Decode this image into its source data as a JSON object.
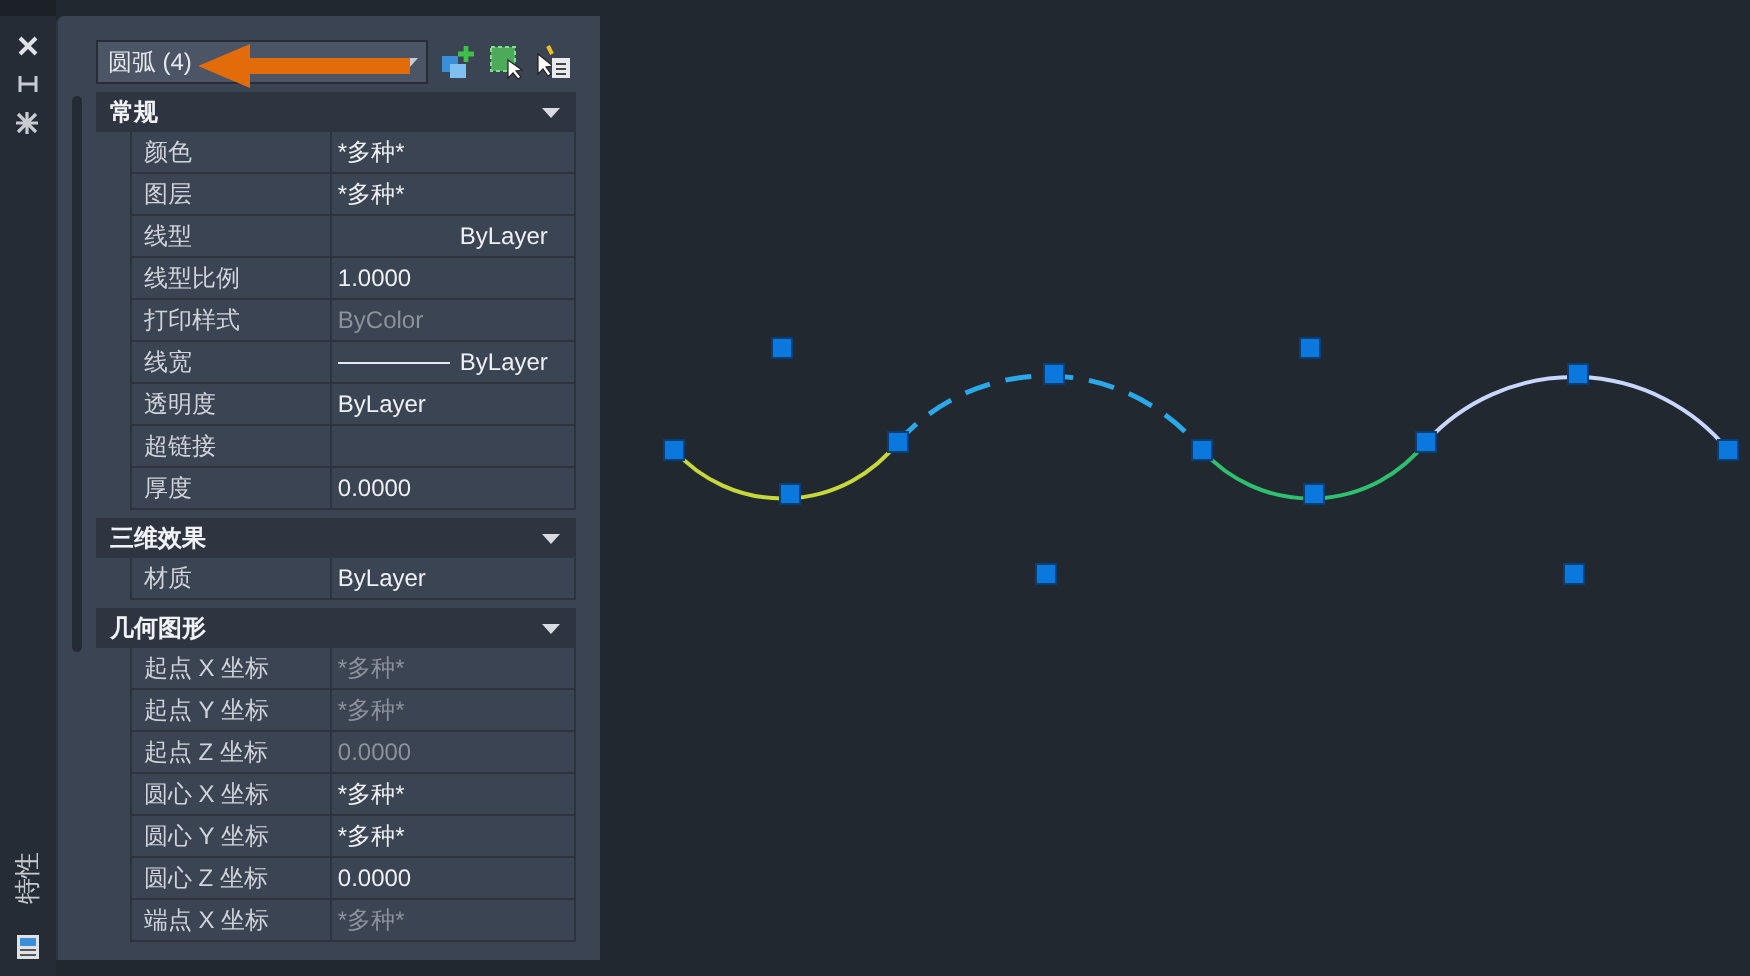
{
  "side_tab": {
    "label": "特性"
  },
  "panel": {
    "selector": {
      "value": "圆弧 (4)"
    },
    "sections": [
      {
        "title": "常规",
        "expanded": true,
        "rows": [
          {
            "label": "颜色",
            "value": "*多种*",
            "kind": "text",
            "disabled": false
          },
          {
            "label": "图层",
            "value": "*多种*",
            "kind": "text",
            "disabled": false
          },
          {
            "label": "线型",
            "value": "ByLayer",
            "kind": "linetype",
            "disabled": false
          },
          {
            "label": "线型比例",
            "value": "1.0000",
            "kind": "text",
            "disabled": false
          },
          {
            "label": "打印样式",
            "value": "ByColor",
            "kind": "text",
            "disabled": true
          },
          {
            "label": "线宽",
            "value": "ByLayer",
            "kind": "lineweight",
            "disabled": false
          },
          {
            "label": "透明度",
            "value": "ByLayer",
            "kind": "text",
            "disabled": false
          },
          {
            "label": "超链接",
            "kind": "text",
            "disabled": false
          },
          {
            "label": "厚度",
            "value": "0.0000",
            "kind": "text",
            "disabled": false
          }
        ]
      },
      {
        "title": "三维效果",
        "expanded": true,
        "rows": [
          {
            "label": "材质",
            "value": "ByLayer",
            "kind": "text",
            "disabled": false
          }
        ]
      },
      {
        "title": "几何图形",
        "expanded": true,
        "rows": [
          {
            "label": "起点 X 坐标",
            "value": "*多种*",
            "kind": "text",
            "disabled": true
          },
          {
            "label": "起点 Y 坐标",
            "value": "*多种*",
            "kind": "text",
            "disabled": true
          },
          {
            "label": "起点 Z 坐标",
            "value": "0.0000",
            "kind": "text",
            "disabled": true
          },
          {
            "label": "圆心 X 坐标",
            "value": "*多种*",
            "kind": "text",
            "disabled": false
          },
          {
            "label": "圆心 Y 坐标",
            "value": "*多种*",
            "kind": "text",
            "disabled": false
          },
          {
            "label": "圆心 Z 坐标",
            "value": "0.0000",
            "kind": "text",
            "disabled": false
          },
          {
            "label": "端点 X 坐标",
            "value": "*多种*",
            "kind": "text",
            "disabled": true
          }
        ]
      }
    ]
  }
}
